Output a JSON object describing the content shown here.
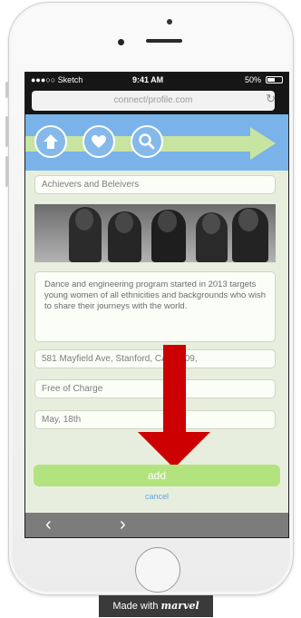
{
  "status": {
    "carrier": "●●●○○ Sketch",
    "time": "9:41 AM",
    "battery": "50%"
  },
  "browser": {
    "url": "connect/profile.com",
    "reload_icon": "reload-icon"
  },
  "banner": {
    "icons": [
      "home-icon",
      "heart-icon",
      "search-icon"
    ],
    "accent": "#79b3e9"
  },
  "form": {
    "title": "Achievers and Beleivers",
    "description": "Dance and engineering program started in 2013 targets young women of all ethnicities and backgrounds who wish to share their journeys with the world.",
    "address": "581 Mayfield Ave, Stanford, CA 94309,",
    "price": "Free of Charge",
    "date": "May, 18th"
  },
  "actions": {
    "add": "add",
    "cancel": "cancel"
  },
  "toolbar": {
    "back": "‹",
    "forward": "›"
  },
  "footer": {
    "made_with": "Made with ",
    "brand": "marvel"
  }
}
